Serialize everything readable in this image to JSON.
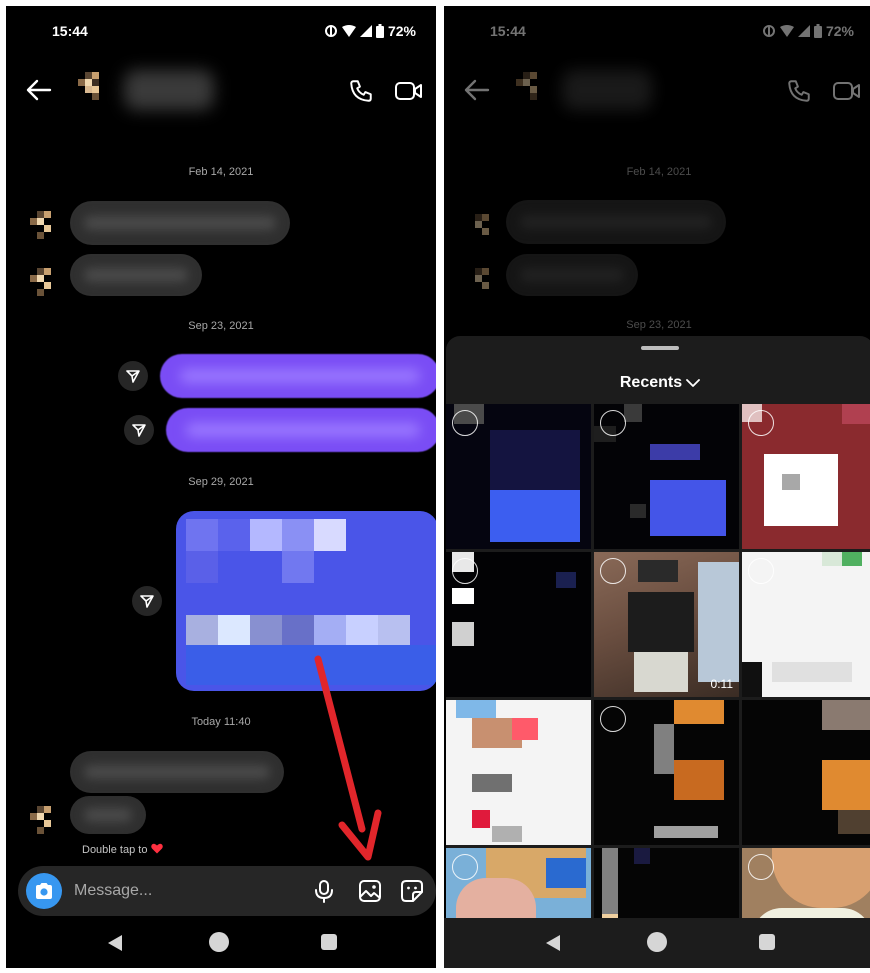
{
  "status_bar": {
    "time": "15:44",
    "battery": "72%"
  },
  "conversation": {
    "date_separators": [
      "Feb 14, 2021",
      "Sep 23, 2021",
      "Sep 29, 2021",
      "Today 11:40"
    ],
    "double_tap_hint": "Double tap to",
    "composer_placeholder": "Message..."
  },
  "gallery": {
    "dropdown_label": "Recents",
    "video_duration": "0:11"
  },
  "colors": {
    "accent_blue": "#3797f0",
    "sent_bubble": "#7a4df5",
    "annotation_arrow": "#e1262b",
    "heart": "#ff3040"
  },
  "icons": [
    "back-arrow-icon",
    "phone-icon",
    "video-camera-icon",
    "share-icon",
    "camera-icon",
    "microphone-icon",
    "gallery-icon",
    "sticker-icon",
    "chevron-down-icon",
    "heart-icon"
  ]
}
